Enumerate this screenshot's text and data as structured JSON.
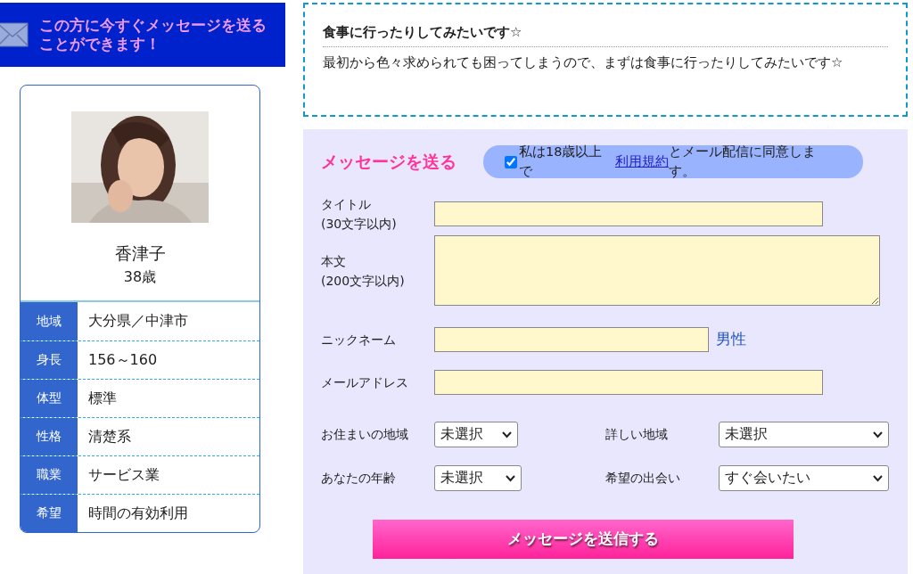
{
  "banner": {
    "text": "この方に今すぐメッセージを送ることができます！"
  },
  "profile": {
    "name": "香津子",
    "age": "38歳",
    "rows": [
      {
        "label": "地域",
        "value": "大分県／中津市"
      },
      {
        "label": "身長",
        "value": "156～160"
      },
      {
        "label": "体型",
        "value": "標準"
      },
      {
        "label": "性格",
        "value": "清楚系"
      },
      {
        "label": "職業",
        "value": "サービス業"
      },
      {
        "label": "希望",
        "value": "時間の有効利用"
      }
    ]
  },
  "intro": {
    "title": "食事に行ったりしてみたいです☆",
    "body": "最初から色々求められても困ってしまうので、まずは食事に行ったりしてみたいです☆"
  },
  "form": {
    "heading": "メッセージを送る",
    "agreement": {
      "checked": true,
      "before": "私は18歳以上で",
      "link": "利用規約",
      "after": "とメール配信に同意します。"
    },
    "fields": [
      {
        "kind": "text",
        "label": "タイトル",
        "note": "(30文字以内)"
      },
      {
        "kind": "textarea",
        "label": "本文",
        "note": "(200文字以内)"
      },
      {
        "kind": "short",
        "label": "ニックネーム",
        "suffix": "男性"
      },
      {
        "kind": "text",
        "label": "メールアドレス"
      }
    ],
    "selects": [
      {
        "label": "お住まいの地域",
        "value": "未選択"
      },
      {
        "label": "詳しい地域",
        "value": "未選択"
      },
      {
        "label": "あなたの年齢",
        "value": "未選択"
      },
      {
        "label": "希望の出会い",
        "value": "すぐ会いたい"
      }
    ],
    "submit": "メッセージを送信する"
  }
}
